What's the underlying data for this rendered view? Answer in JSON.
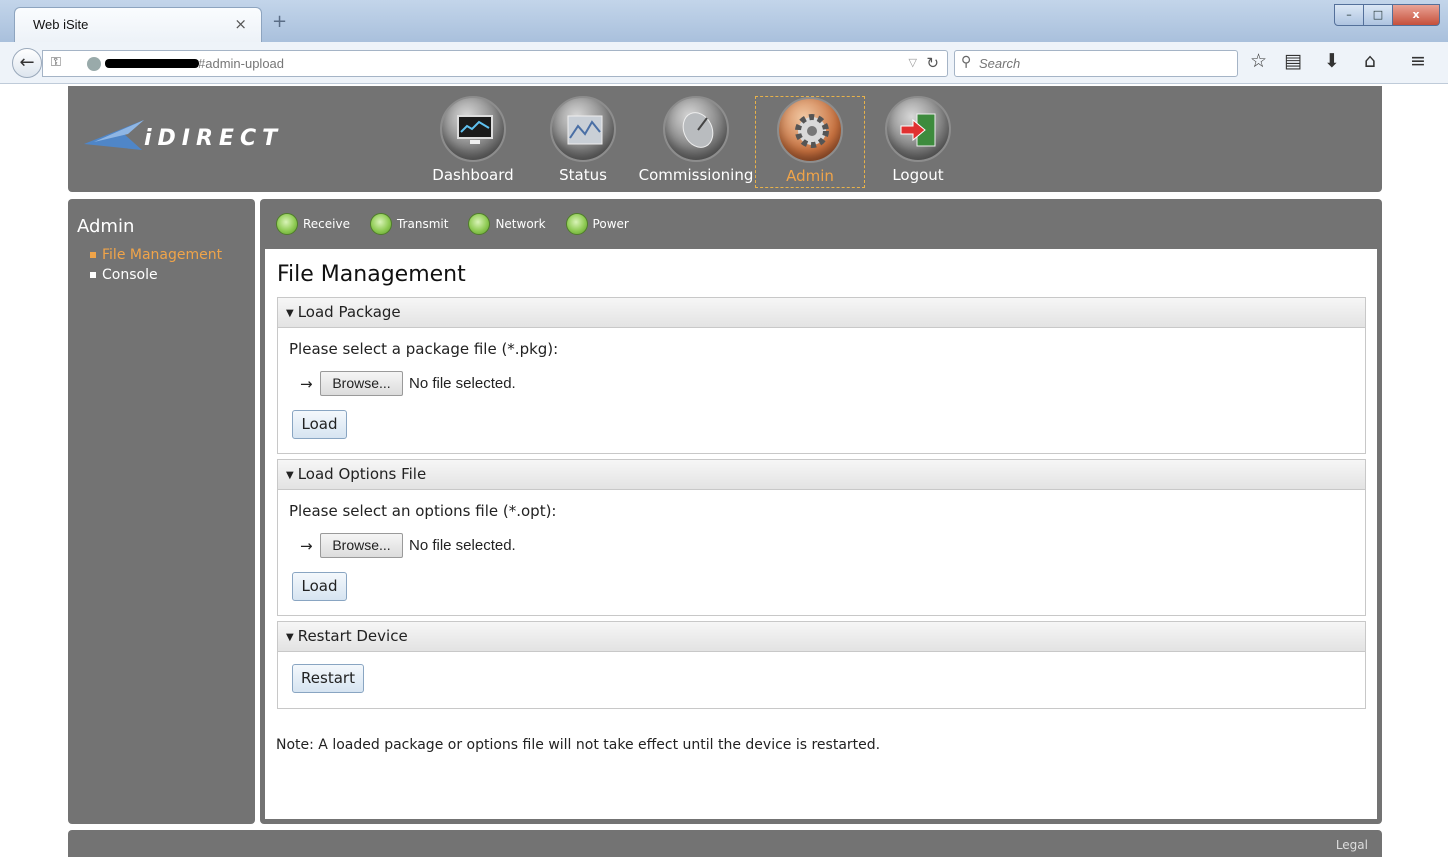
{
  "browser": {
    "tab_title": "Web iSite",
    "tab_close": "×",
    "new_tab": "+",
    "url_suffix": "#admin-upload",
    "search_placeholder": "Search",
    "window_buttons": {
      "minimize": "–",
      "maximize": "□",
      "close": "x"
    }
  },
  "header": {
    "logo_text": "iDIRECT",
    "nav": [
      {
        "label": "Dashboard",
        "icon": "monitor-icon",
        "active": false
      },
      {
        "label": "Status",
        "icon": "chart-icon",
        "active": false
      },
      {
        "label": "Commissioning",
        "icon": "satellite-dish-icon",
        "active": false
      },
      {
        "label": "Admin",
        "icon": "gear-icon",
        "active": true
      },
      {
        "label": "Logout",
        "icon": "exit-door-icon",
        "active": false
      }
    ]
  },
  "sidebar": {
    "title": "Admin",
    "items": [
      {
        "label": "File Management",
        "active": true
      },
      {
        "label": "Console",
        "active": false
      }
    ]
  },
  "status_indicators": [
    {
      "label": "Receive",
      "color": "#8fcb54"
    },
    {
      "label": "Transmit",
      "color": "#8fcb54"
    },
    {
      "label": "Network",
      "color": "#8fcb54"
    },
    {
      "label": "Power",
      "color": "#8fcb54"
    }
  ],
  "main": {
    "title": "File Management",
    "sections": {
      "load_package": {
        "header": "Load Package",
        "prompt": "Please select a package file (*.pkg):",
        "arrow": "→",
        "browse_label": "Browse...",
        "file_status": "No file selected.",
        "button": "Load"
      },
      "load_options": {
        "header": "Load Options File",
        "prompt": "Please select an options file (*.opt):",
        "arrow": "→",
        "browse_label": "Browse...",
        "file_status": "No file selected.",
        "button": "Load"
      },
      "restart": {
        "header": "Restart Device",
        "button": "Restart"
      }
    },
    "note": "Note: A loaded package or options file will not take effect until the device is restarted."
  },
  "footer": {
    "legal": "Legal"
  },
  "colors": {
    "panel_gray": "#737373",
    "active_orange": "#f0a449",
    "status_green": "#8fcb54"
  }
}
